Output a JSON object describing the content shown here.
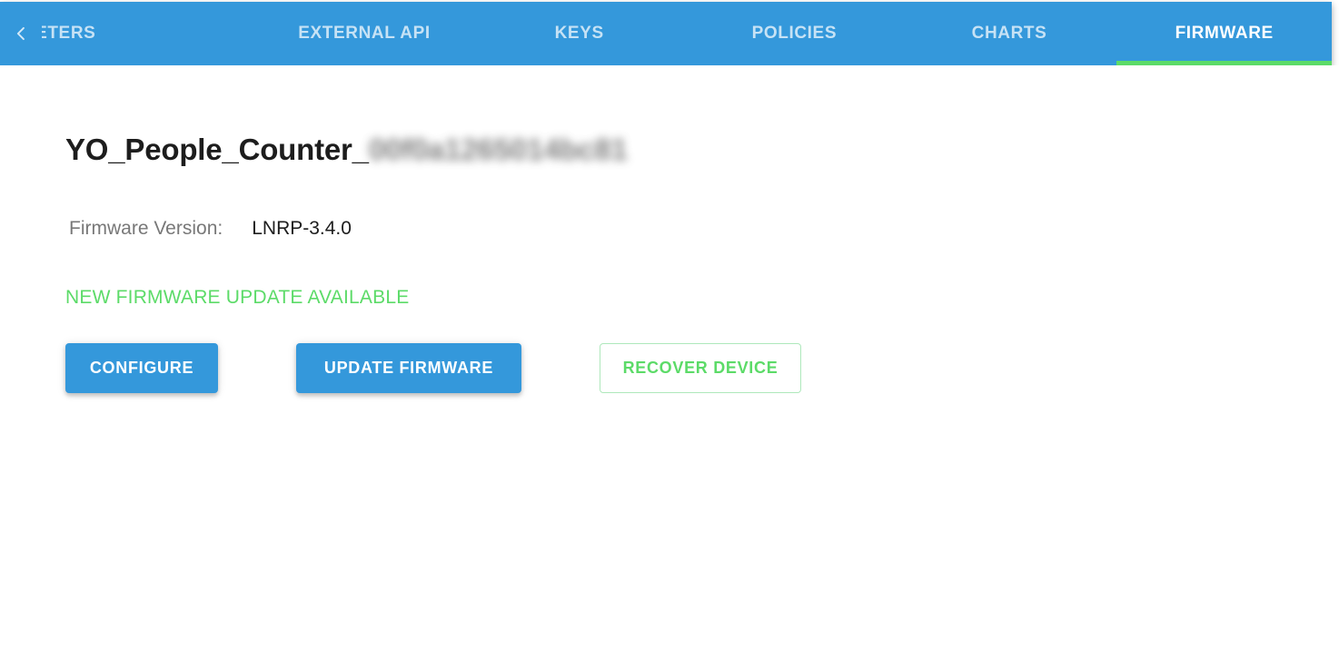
{
  "tabbar": {
    "scroll_left_icon": "chevron-left-icon",
    "accent_color": "#3498db",
    "active_indicator_color": "#5cdb68",
    "tabs": [
      {
        "label": "RAMETERS",
        "full_label": "PARAMETERS",
        "active": false,
        "clipped": true
      },
      {
        "label": "EXTERNAL API",
        "active": false,
        "clipped": false
      },
      {
        "label": "KEYS",
        "active": false,
        "clipped": false
      },
      {
        "label": "POLICIES",
        "active": false,
        "clipped": false
      },
      {
        "label": "CHARTS",
        "active": false,
        "clipped": false
      },
      {
        "label": "FIRMWARE",
        "active": true,
        "clipped": false
      }
    ]
  },
  "device": {
    "title_prefix": "YO_People_Counter_",
    "title_redacted_suffix": "00f0a1265014bc81",
    "firmware_label": "Firmware Version:",
    "firmware_value": "LNRP-3.4.0",
    "update_notice": "NEW FIRMWARE UPDATE AVAILABLE",
    "update_notice_color": "#5cdb68"
  },
  "actions": {
    "configure_label": "CONFIGURE",
    "update_firmware_label": "UPDATE FIRMWARE",
    "recover_device_label": "RECOVER DEVICE"
  }
}
